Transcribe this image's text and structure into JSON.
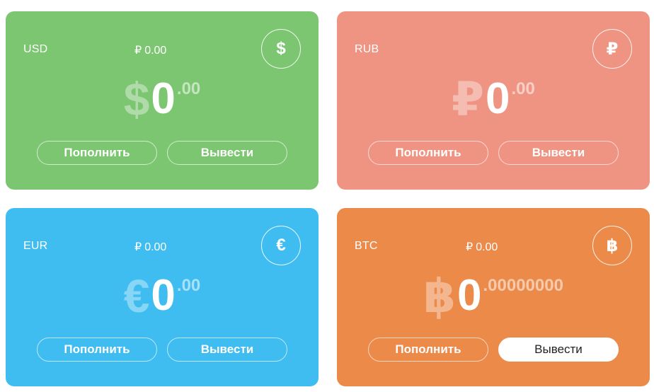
{
  "wallets": [
    {
      "code": "USD",
      "rate_symbol": "₽",
      "rate_value": "0.00",
      "icon_symbol": "$",
      "balance_symbol": "$",
      "balance_int": "0",
      "balance_dec": ".00",
      "deposit_label": "Пополнить",
      "withdraw_label": "Вывести",
      "color": "#7cc672"
    },
    {
      "code": "RUB",
      "rate_symbol": "",
      "rate_value": "",
      "icon_symbol": "₽",
      "balance_symbol": "₽",
      "balance_int": "0",
      "balance_dec": ".00",
      "deposit_label": "Пополнить",
      "withdraw_label": "Вывести",
      "color": "#ef9482"
    },
    {
      "code": "EUR",
      "rate_symbol": "₽",
      "rate_value": "0.00",
      "icon_symbol": "€",
      "balance_symbol": "€",
      "balance_int": "0",
      "balance_dec": ".00",
      "deposit_label": "Пополнить",
      "withdraw_label": "Вывести",
      "color": "#3fbdf1"
    },
    {
      "code": "BTC",
      "rate_symbol": "₽",
      "rate_value": "0.00",
      "icon_symbol": "฿",
      "balance_symbol": "฿",
      "balance_int": "0",
      "balance_dec": ".00000000",
      "deposit_label": "Пополнить",
      "withdraw_label": "Вывести",
      "color": "#ec8a4a"
    }
  ]
}
